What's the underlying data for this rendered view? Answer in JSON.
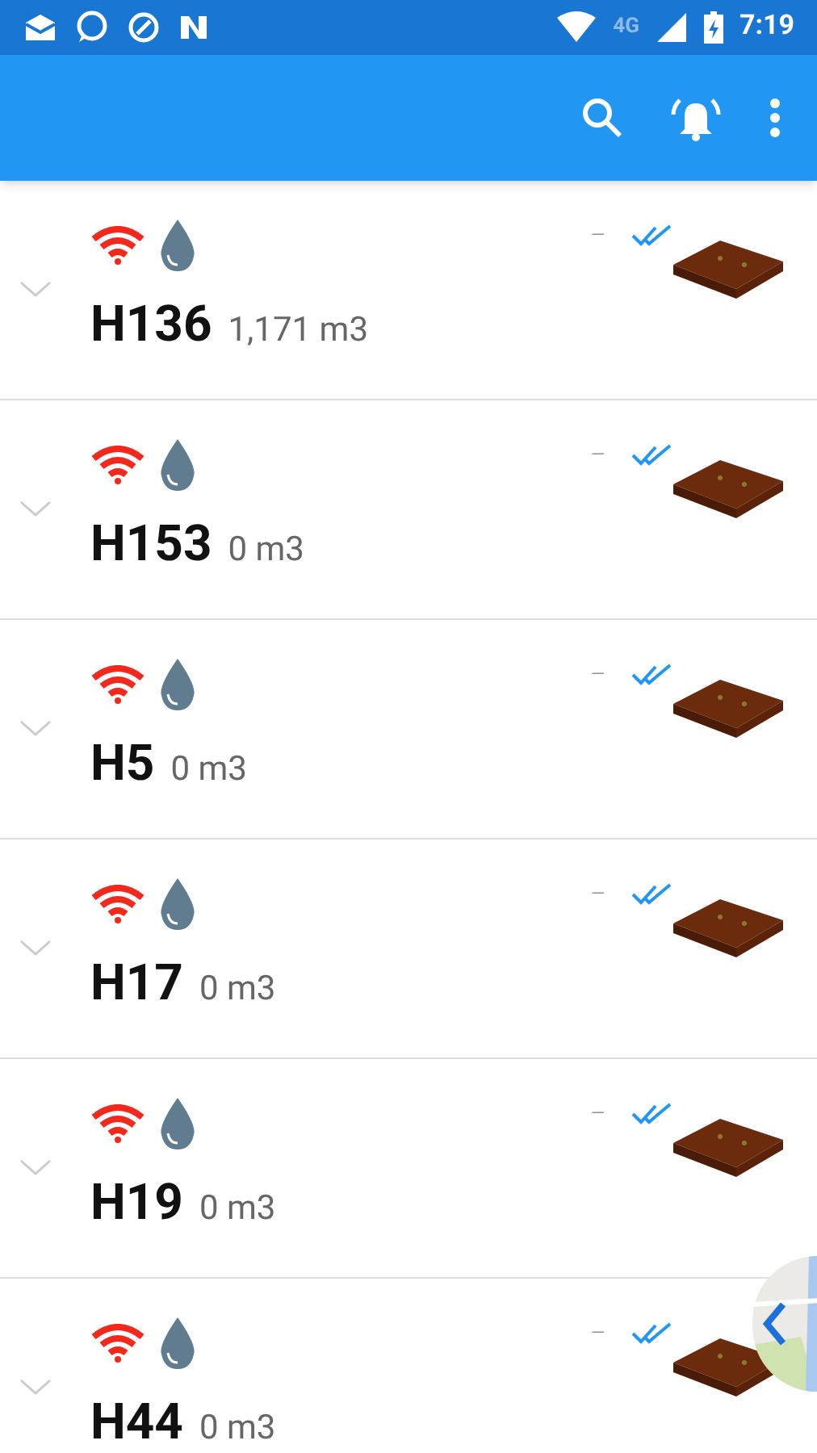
{
  "status_bar": {
    "network": "4G",
    "time": "7:19"
  },
  "rows": [
    {
      "name": "H136",
      "volume": "1,171 m3",
      "reading": "—"
    },
    {
      "name": "H153",
      "volume": "0 m3",
      "reading": "—"
    },
    {
      "name": "H5",
      "volume": "0 m3",
      "reading": "—"
    },
    {
      "name": "H17",
      "volume": "0 m3",
      "reading": "—"
    },
    {
      "name": "H19",
      "volume": "0 m3",
      "reading": "—"
    },
    {
      "name": "H44",
      "volume": "0 m3",
      "reading": "—"
    }
  ]
}
